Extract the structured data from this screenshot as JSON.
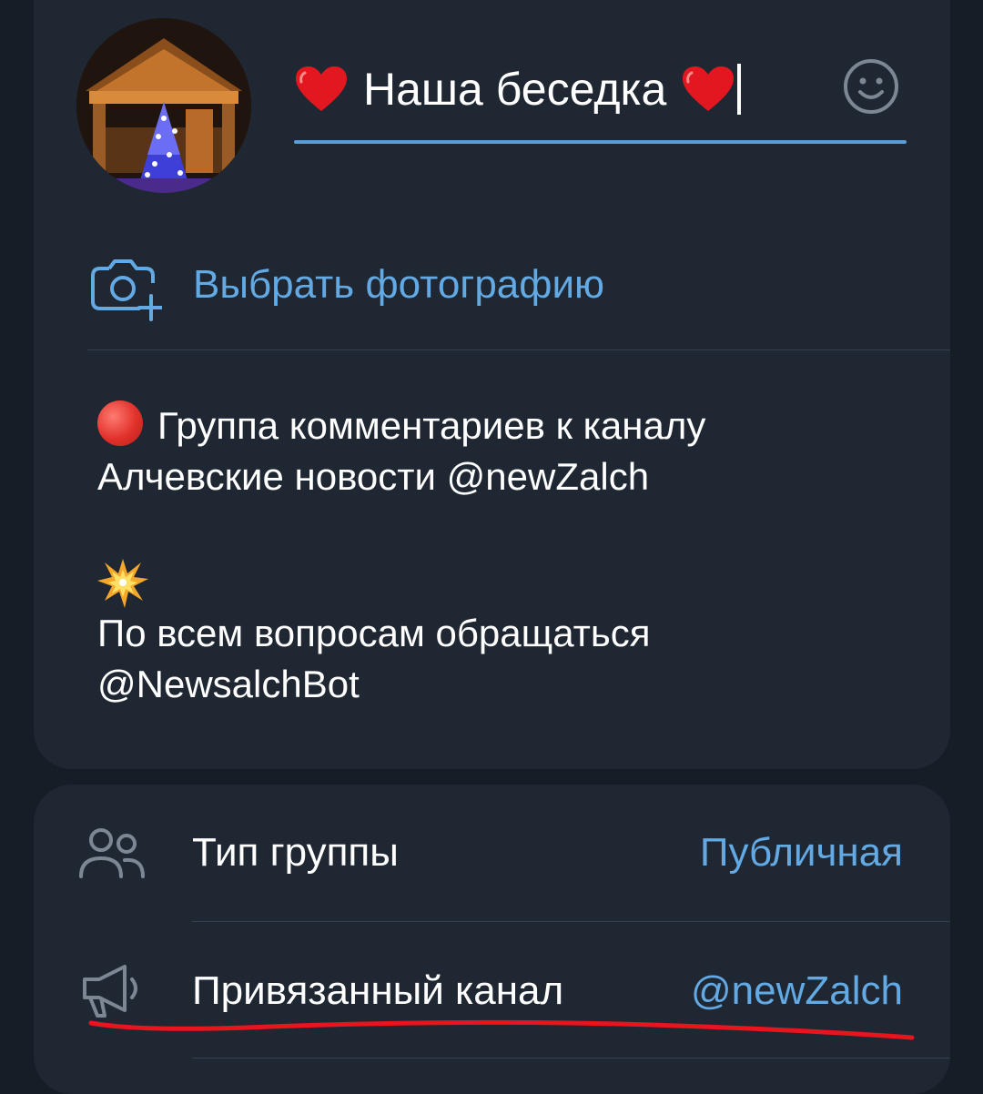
{
  "group": {
    "name": "Наша беседка",
    "emoji_button_icon": "smile-icon",
    "choose_photo_label": "Выбрать фотографию",
    "description_lines": [
      "Группа комментариев к каналу",
      "Алчевские новости @newZalch",
      "",
      "По всем вопросам обращаться",
      "@NewsalchBot"
    ]
  },
  "settings": [
    {
      "label": "Тип группы",
      "value": "Публичная",
      "icon": "people-icon"
    },
    {
      "label": "Привязанный канал",
      "value": "@newZalch",
      "icon": "megaphone-icon"
    }
  ],
  "colors": {
    "background": "#151d27",
    "card": "#1f2733",
    "accent": "#63a9e3",
    "underline": "#5a9bd8",
    "divider": "#33404f",
    "annotation": "#e8141e"
  }
}
